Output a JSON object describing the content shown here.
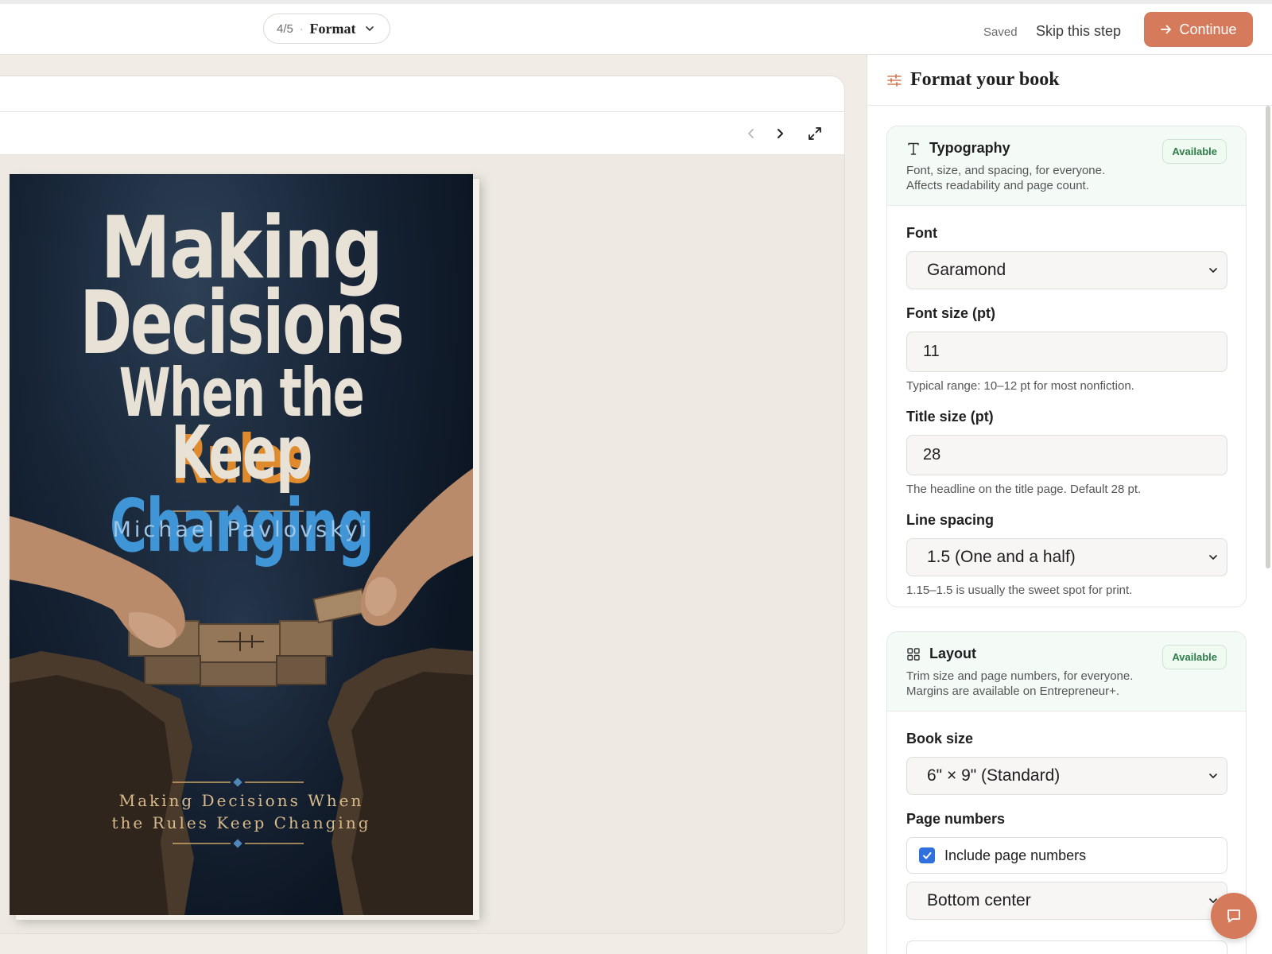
{
  "topbar": {
    "step_count": "4/5",
    "step_separator": "·",
    "step_name": "Format",
    "saved_label": "Saved",
    "skip_label": "Skip this step",
    "continue_label": "Continue"
  },
  "preview": {
    "prev_icon": "chevron-left-icon",
    "next_icon": "chevron-right-icon",
    "expand_icon": "expand-icon"
  },
  "cover": {
    "title_line1": "Making",
    "title_line2": "Decisions",
    "title_line3a": "When the",
    "title_line3b": "Rules",
    "title_line4a": "Keep",
    "title_line4b": "Changing",
    "author": "Michael Pavlovskyi",
    "subtitle_line1": "Making Decisions When",
    "subtitle_line2": "the Rules Keep Changing"
  },
  "panel": {
    "title": "Format your book",
    "typography": {
      "title": "Typography",
      "badge": "Available",
      "desc_line1": "Font, size, and spacing, for everyone.",
      "desc_line2": "Affects readability and page count.",
      "font_label": "Font",
      "font_value": "Garamond",
      "font_size_label": "Font size (pt)",
      "font_size_value": "11",
      "font_size_hint": "Typical range: 10–12 pt for most nonfiction.",
      "title_size_label": "Title size (pt)",
      "title_size_value": "28",
      "title_size_hint": "The headline on the title page. Default 28 pt.",
      "line_spacing_label": "Line spacing",
      "line_spacing_value": "1.5 (One and a half)",
      "line_spacing_hint": "1.15–1.5 is usually the sweet spot for print."
    },
    "layout": {
      "title": "Layout",
      "badge": "Available",
      "desc_line1": "Trim size and page numbers, for everyone.",
      "desc_line2": "Margins are available on Entrepreneur+.",
      "book_size_label": "Book size",
      "book_size_value": "6\" × 9\" (Standard)",
      "page_numbers_label": "Page numbers",
      "include_page_numbers_label": "Include page numbers",
      "include_page_numbers_checked": true,
      "position_value": "Bottom center"
    }
  },
  "colors": {
    "accent": "#d57a5a",
    "badge_green": "#2e7d4b",
    "checkbox_blue": "#2f6fde",
    "cover_orange": "#e08a2e",
    "cover_blue": "#3f95d6"
  }
}
